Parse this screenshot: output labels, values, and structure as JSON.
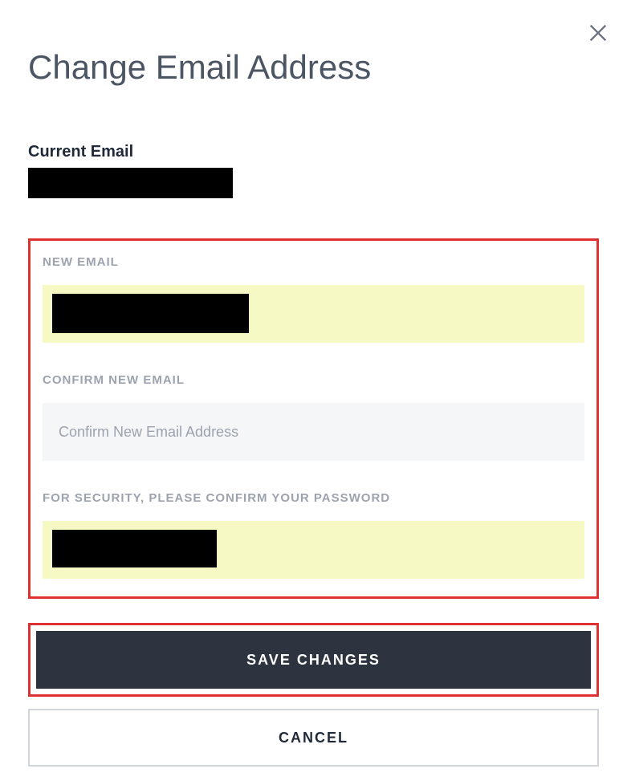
{
  "header": {
    "title": "Change Email Address"
  },
  "current_email": {
    "label": "Current Email"
  },
  "form": {
    "new_email": {
      "label": "NEW EMAIL"
    },
    "confirm_email": {
      "label": "CONFIRM NEW EMAIL",
      "placeholder": "Confirm New Email Address"
    },
    "password": {
      "label": "FOR SECURITY, PLEASE CONFIRM YOUR PASSWORD"
    }
  },
  "buttons": {
    "save": "SAVE CHANGES",
    "cancel": "CANCEL"
  }
}
